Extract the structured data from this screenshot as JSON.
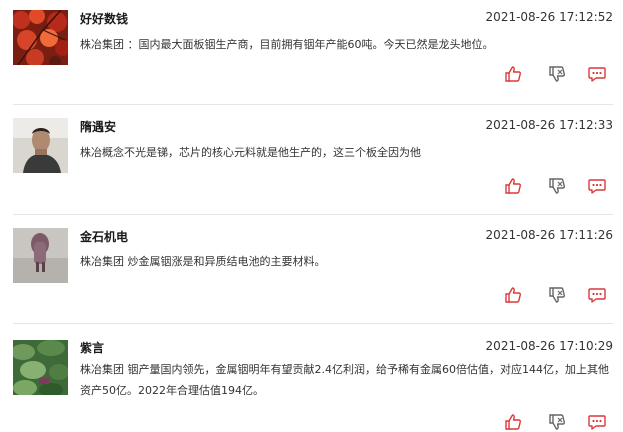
{
  "posts": [
    {
      "user": "好好数钱",
      "time": "2021-08-26 17:12:52",
      "content": "株冶集团 ：国内最大面板铟生产商，目前拥有铟年产能60吨。今天已然是龙头地位。",
      "avatar": "red-leaves-avatar"
    },
    {
      "user": "隋遇安",
      "time": "2021-08-26 17:12:33",
      "content": "株冶概念不光是锑，芯片的核心元料就是他生产的，这三个板全因为他",
      "avatar": "man-portrait-avatar"
    },
    {
      "user": "金石机电",
      "time": "2021-08-26 17:11:26",
      "content": "株冶集团 炒金属铟涨是和异质结电池的主要材料。",
      "avatar": "figure-avatar"
    },
    {
      "user": "紫言",
      "time": "2021-08-26 17:10:29",
      "content": "株冶集团 铟产量国内领先，金属铟明年有望贡献2.4亿利润，给予稀有金属60倍估值，对应144亿，加上其他资产50亿。2022年合理估值194亿。",
      "avatar": "green-plants-avatar"
    }
  ],
  "icons": {
    "like": "thumbs-up-icon",
    "dislike": "thumbs-down-icon",
    "comment": "comment-icon"
  },
  "colors": {
    "accent": "#d9393b",
    "neutral_icon": "#666666",
    "divider": "#e6e6e6"
  }
}
